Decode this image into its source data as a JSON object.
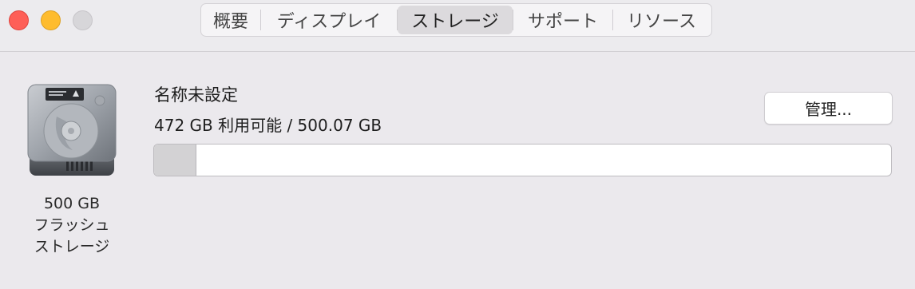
{
  "window": {
    "tabs": [
      {
        "label": "概要",
        "selected": false
      },
      {
        "label": "ディスプレイ",
        "selected": false
      },
      {
        "label": "ストレージ",
        "selected": true
      },
      {
        "label": "サポート",
        "selected": false
      },
      {
        "label": "リソース",
        "selected": false
      }
    ]
  },
  "disk": {
    "icon": "hard-drive-icon",
    "caption_line1": "500 GB",
    "caption_line2": "フラッシュ",
    "caption_line3": "ストレージ"
  },
  "volume": {
    "name": "名称未設定",
    "usage": "472 GB 利用可能 / 500.07 GB",
    "used_fraction": 0.056,
    "manage_label": "管理..."
  },
  "colors": {
    "close": "#fe5f57",
    "minimize": "#febc2e",
    "maximize": "#d7d6d9",
    "bar_used": "#d3d2d4"
  }
}
